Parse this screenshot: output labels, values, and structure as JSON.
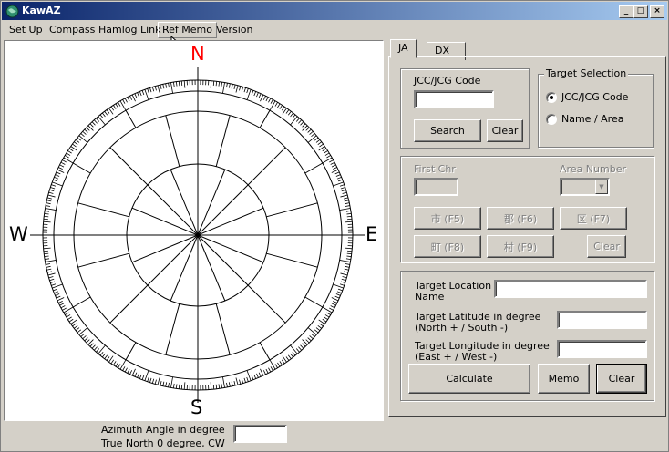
{
  "window": {
    "title": "KawAZ",
    "controls": {
      "minimize": "_",
      "maximize": "□",
      "close": "×"
    }
  },
  "menu": [
    "Set Up",
    "Compass",
    "Hamlog Link",
    "Ref Memo",
    "Version"
  ],
  "compass": {
    "north": "N",
    "south": "S",
    "east": "E",
    "west": "W",
    "north_color": "#ff0000",
    "azimuth_label_1": "Azimuth Angle in degree",
    "azimuth_label_2": "True North 0 degree, CW",
    "azimuth_value": ""
  },
  "tabs": [
    "JA",
    "DX"
  ],
  "active_tab": "JA",
  "jcc": {
    "group_title": "JCC/JCG Code",
    "code_value": "",
    "search_label": "Search",
    "clear_label": "Clear"
  },
  "target_selection": {
    "group_title": "Target Selection",
    "options": [
      "JCC/JCG Code",
      "Name / Area"
    ],
    "selected": "JCC/JCG Code"
  },
  "area": {
    "first_chr_label": "First Chr",
    "area_number_label": "Area Number",
    "buttons": [
      "市 (F5)",
      "郡 (F6)",
      "区 (F7)",
      "町 (F8)",
      "村 (F9)",
      "Clear"
    ]
  },
  "target": {
    "location_label_1": "Target Location",
    "location_label_2": "Name",
    "lat_label_1": "Target Latitude in degree",
    "lat_label_2": "(North + / South -)",
    "lon_label_1": "Target Longitude in degree",
    "lon_label_2": "(East + / West -)",
    "location_value": "",
    "lat_value": "",
    "lon_value": "",
    "calculate_label": "Calculate",
    "memo_label": "Memo",
    "clear_label": "Clear"
  }
}
